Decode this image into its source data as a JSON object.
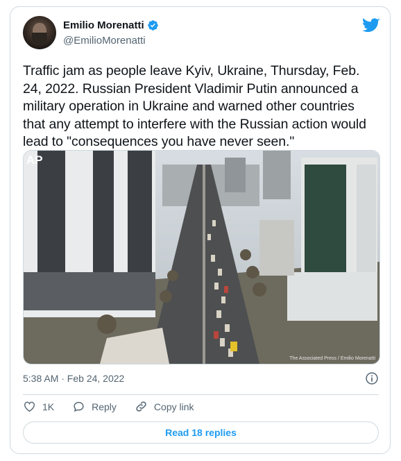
{
  "author": {
    "name": "Emilio Morenatti",
    "handle": "@EmilioMorenatti",
    "verified": true
  },
  "tweet": {
    "text": "Traffic jam as people leave Kyiv, Ukraine, Thursday, Feb. 24, 2022. Russian President Vladimir Putin announced a military operation in Ukraine and warned other countries that any attempt to interfere with the Russian action would lead to \"consequences you have never seen.\"",
    "timestamp": "5:38 AM · Feb 24, 2022"
  },
  "media": {
    "logo_text": "AP",
    "credit": "The Associated Press / Emilio Morenatti"
  },
  "actions": {
    "like_count": "1K",
    "reply_label": "Reply",
    "copy_link_label": "Copy link"
  },
  "footer": {
    "read_replies_label": "Read 18 replies"
  },
  "colors": {
    "twitter_blue": "#1d9bf0",
    "secondary_text": "#536471",
    "border": "#cfd9de"
  },
  "icons": {
    "verified": "verified-badge-icon",
    "brand": "twitter-bird-icon",
    "info": "info-icon",
    "like": "heart-icon",
    "reply": "speech-bubble-icon",
    "copy_link": "link-icon"
  }
}
